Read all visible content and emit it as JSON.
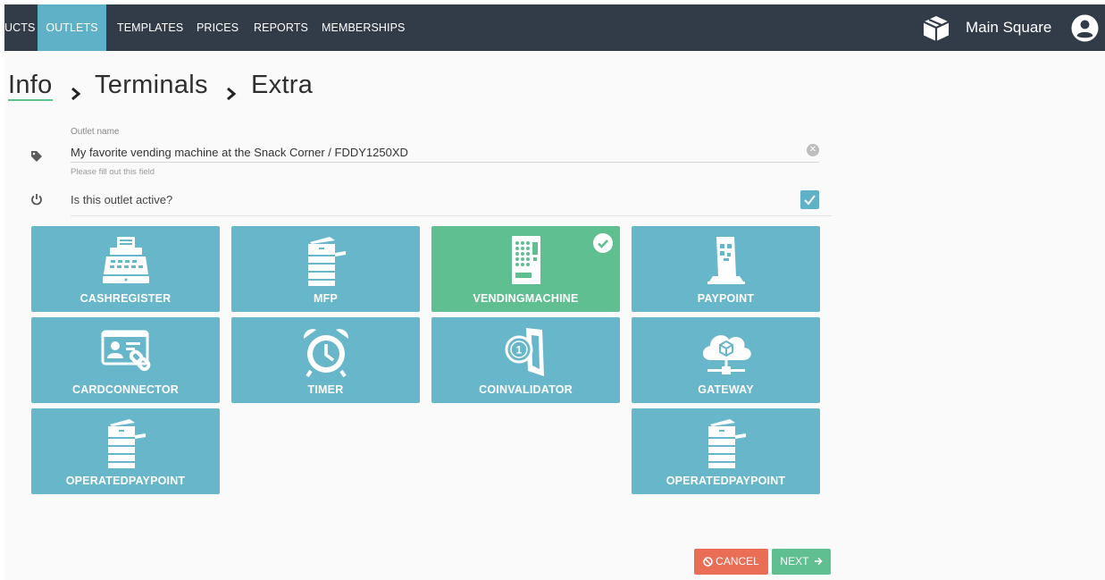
{
  "nav": {
    "items": [
      {
        "label": "UCTS",
        "active": false
      },
      {
        "label": "OUTLETS",
        "active": true
      },
      {
        "label": "TEMPLATES",
        "active": false
      },
      {
        "label": "PRICES",
        "active": false
      },
      {
        "label": "REPORTS",
        "active": false
      },
      {
        "label": "MEMBERSHIPS",
        "active": false
      }
    ],
    "brand_name": "Main Square",
    "brand_icon": "box-icon",
    "user_icon": "user-circle-icon"
  },
  "breadcrumb": {
    "steps": [
      "Info",
      "Terminals",
      "Extra"
    ],
    "current_index": 0,
    "separator_icon": "chevron-right-icon"
  },
  "form": {
    "outlet_name": {
      "label": "Outlet name",
      "value": "My favorite vending machine at the Snack Corner / FDDY1250XD",
      "hint": "Please fill out this field",
      "icon": "tag-icon",
      "clear_icon": "clear-icon"
    },
    "active": {
      "label": "Is this outlet active?",
      "checked": true,
      "icon": "power-icon"
    }
  },
  "terminal_types": [
    {
      "label": "CASHREGISTER",
      "icon": "cash-register-icon",
      "selected": false
    },
    {
      "label": "MFP",
      "icon": "printer-icon",
      "selected": false
    },
    {
      "label": "VENDINGMACHINE",
      "icon": "vending-machine-icon",
      "selected": true
    },
    {
      "label": "PAYPOINT",
      "icon": "paypoint-icon",
      "selected": false
    },
    {
      "label": "CARDCONNECTOR",
      "icon": "card-connector-icon",
      "selected": false
    },
    {
      "label": "TIMER",
      "icon": "alarm-clock-icon",
      "selected": false
    },
    {
      "label": "COINVALIDATOR",
      "icon": "coin-validator-icon",
      "selected": false
    },
    {
      "label": "GATEWAY",
      "icon": "cloud-gateway-icon",
      "selected": false
    },
    {
      "label": "OPERATEDPAYPOINT",
      "icon": "printer-icon",
      "selected": false
    },
    {
      "label": "OPERATEDPAYPOINT",
      "icon": "printer-icon",
      "selected": false
    }
  ],
  "buttons": {
    "cancel": "CANCEL",
    "next": "NEXT"
  },
  "colors": {
    "nav_bg": "#323b48",
    "accent": "#5fb1c8",
    "tile": "#68b6ca",
    "selected_tile": "#60bf91",
    "cancel": "#ea6d55",
    "next": "#5fbf90"
  }
}
